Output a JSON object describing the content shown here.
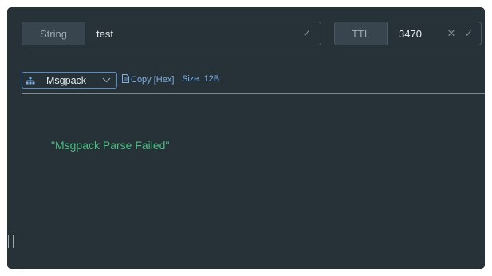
{
  "type_field": {
    "label": "String",
    "value": "test",
    "confirm_icon": "check-icon"
  },
  "ttl_field": {
    "label": "TTL",
    "value": "3470",
    "clear_icon": "close-icon",
    "confirm_icon": "check-icon"
  },
  "format_select": {
    "icon": "tree-icon",
    "value": "Msgpack"
  },
  "copy_link": {
    "icon": "file-icon",
    "label": "Copy [Hex]"
  },
  "size_info": "Size: 12B",
  "editor": {
    "content": "\"Msgpack Parse Failed\""
  },
  "colors": {
    "background": "#263238",
    "accent": "#4e8fd1",
    "string": "#4dbb7f",
    "link": "#7fb0e6"
  }
}
